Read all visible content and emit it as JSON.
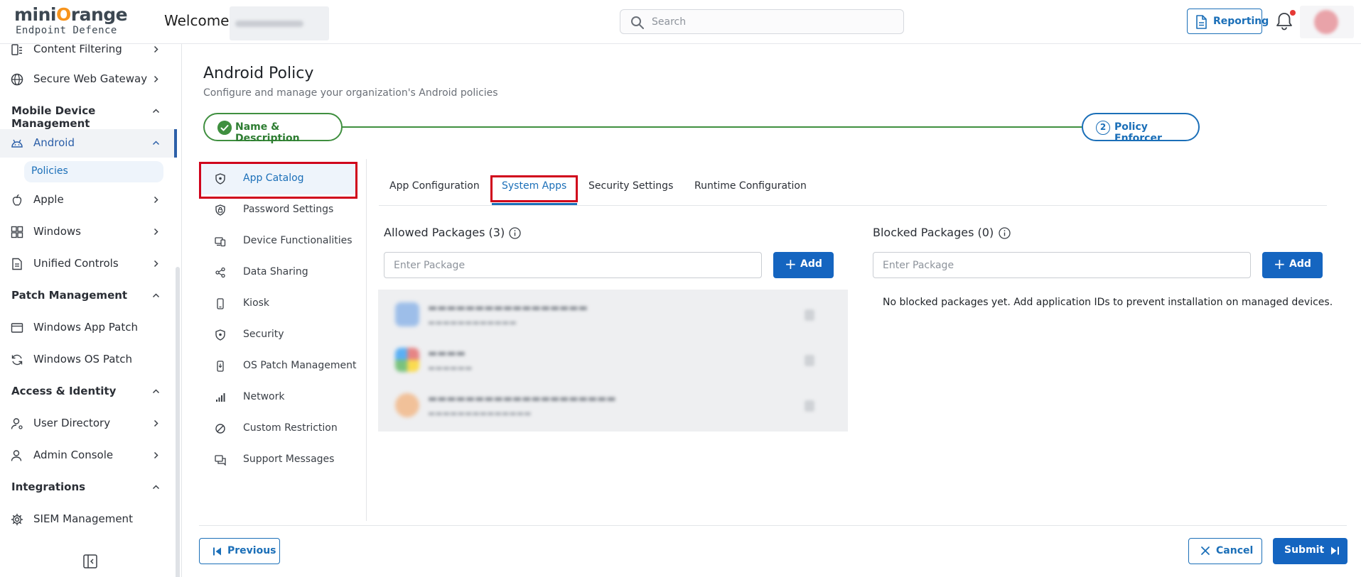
{
  "header": {
    "logo_main_1": "mini",
    "logo_main_o": "O",
    "logo_main_2": "range",
    "logo_sub": "Endpoint Defence",
    "welcome": "Welcome,",
    "search_placeholder": "Search",
    "reporting_label": "Reporting"
  },
  "sidebar": {
    "items": [
      {
        "label": "Content Filtering",
        "icon": "content-filter-icon"
      },
      {
        "label": "Secure Web Gateway",
        "icon": "globe-icon"
      },
      {
        "label": "Mobile Device Management",
        "icon": ""
      },
      {
        "label": "Android",
        "icon": "android-icon"
      },
      {
        "label": "Policies",
        "icon": ""
      },
      {
        "label": "Apple",
        "icon": "apple-icon"
      },
      {
        "label": "Windows",
        "icon": "windows-icon"
      },
      {
        "label": "Unified Controls",
        "icon": "document-icon"
      },
      {
        "label": "Patch Management",
        "icon": ""
      },
      {
        "label": "Windows App Patch",
        "icon": "window-icon"
      },
      {
        "label": "Windows OS Patch",
        "icon": "refresh-icon"
      },
      {
        "label": "Access & Identity",
        "icon": ""
      },
      {
        "label": "User Directory",
        "icon": "user-icon"
      },
      {
        "label": "Admin Console",
        "icon": "user-admin-icon"
      },
      {
        "label": "Integrations",
        "icon": ""
      },
      {
        "label": "SIEM Management",
        "icon": "gear-icon"
      }
    ]
  },
  "page": {
    "title": "Android Policy",
    "subtitle": "Configure and manage your organization's Android policies"
  },
  "stepper": {
    "step1": "Name & Description",
    "step2_num": "2",
    "step2": "Policy Enforcer"
  },
  "left_nav": {
    "items": [
      "App Catalog",
      "Password Settings",
      "Device Functionalities",
      "Data Sharing",
      "Kiosk",
      "Security",
      "OS Patch Management",
      "Network",
      "Custom Restriction",
      "Support Messages"
    ]
  },
  "tabs": [
    "App Configuration",
    "System Apps",
    "Security Settings",
    "Runtime Configuration"
  ],
  "allowed": {
    "title": "Allowed Packages (3)",
    "placeholder": "Enter Package",
    "add_label": "Add"
  },
  "blocked": {
    "title": "Blocked Packages (0)",
    "placeholder": "Enter Package",
    "add_label": "Add",
    "empty_message": "No blocked packages yet. Add application IDs to prevent installation on managed devices."
  },
  "footer": {
    "previous": "Previous",
    "cancel": "Cancel",
    "submit": "Submit"
  },
  "colors": {
    "accent": "#1b6fb8",
    "primary_button": "#1565c0",
    "success": "#3f8f3f",
    "highlight": "#d0021b"
  }
}
